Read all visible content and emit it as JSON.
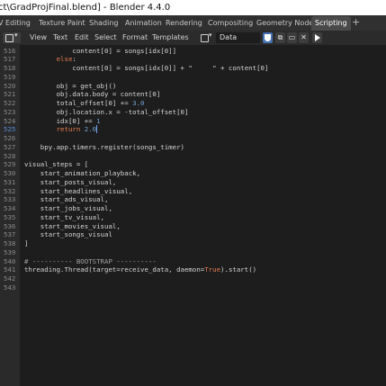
{
  "window": {
    "title": "ct\\GradProjFinal.blend] - Blender 4.4.0"
  },
  "workspace_tabs": [
    {
      "label": "V Editing"
    },
    {
      "label": "Texture Paint"
    },
    {
      "label": "Shading"
    },
    {
      "label": "Animation"
    },
    {
      "label": "Rendering"
    },
    {
      "label": "Compositing"
    },
    {
      "label": "Geometry Nodes"
    },
    {
      "label": "Scripting",
      "active": true
    }
  ],
  "header": {
    "menus": [
      "View",
      "Text",
      "Edit",
      "Select",
      "Format",
      "Templates"
    ],
    "datablock_name": "Data"
  },
  "icons": {
    "editor_type": "text-editor-icon",
    "textblock": "textblock-icon",
    "shield": "shield-icon",
    "copy": "copy-icon",
    "new": "new-file-icon",
    "close": "close-icon",
    "run": "play-icon"
  },
  "editor": {
    "current_line": "525",
    "lines": [
      {
        "num": "516",
        "parts": [
          [
            "t",
            "            content[0] = songs[idx[0]]"
          ]
        ]
      },
      {
        "num": "517",
        "parts": [
          [
            "t",
            "        "
          ],
          [
            "k",
            "else"
          ],
          [
            "t",
            ":"
          ]
        ]
      },
      {
        "num": "518",
        "parts": [
          [
            "t",
            "            content[0] = songs[idx[0]] + \"     \" + content[0]"
          ]
        ]
      },
      {
        "num": "519",
        "parts": [
          [
            "t",
            ""
          ]
        ]
      },
      {
        "num": "520",
        "parts": [
          [
            "t",
            "        obj = get_obj()"
          ]
        ]
      },
      {
        "num": "521",
        "parts": [
          [
            "t",
            "        obj.data.body = content[0]"
          ]
        ]
      },
      {
        "num": "522",
        "parts": [
          [
            "t",
            "        total_offset[0] += "
          ],
          [
            "n",
            "3.0"
          ]
        ]
      },
      {
        "num": "523",
        "parts": [
          [
            "t",
            "        obj.location.x = -total_offset[0]"
          ]
        ]
      },
      {
        "num": "524",
        "parts": [
          [
            "t",
            "        idx[0] += "
          ],
          [
            "n",
            "1"
          ]
        ]
      },
      {
        "num": "525",
        "parts": [
          [
            "t",
            "        "
          ],
          [
            "k",
            "return"
          ],
          [
            "t",
            " "
          ],
          [
            "n",
            "2.0"
          ]
        ]
      },
      {
        "num": "526",
        "parts": [
          [
            "t",
            ""
          ]
        ]
      },
      {
        "num": "527",
        "parts": [
          [
            "t",
            "    bpy.app.timers.register(songs_timer)"
          ]
        ]
      },
      {
        "num": "528",
        "parts": [
          [
            "t",
            ""
          ]
        ]
      },
      {
        "num": "529",
        "parts": [
          [
            "t",
            "visual_steps = ["
          ]
        ]
      },
      {
        "num": "530",
        "parts": [
          [
            "t",
            "    start_animation_playback,"
          ]
        ]
      },
      {
        "num": "531",
        "parts": [
          [
            "t",
            "    start_posts_visual,"
          ]
        ]
      },
      {
        "num": "532",
        "parts": [
          [
            "t",
            "    start_headlines_visual,"
          ]
        ]
      },
      {
        "num": "533",
        "parts": [
          [
            "t",
            "    start_ads_visual,"
          ]
        ]
      },
      {
        "num": "534",
        "parts": [
          [
            "t",
            "    start_jobs_visual,"
          ]
        ]
      },
      {
        "num": "535",
        "parts": [
          [
            "t",
            "    start_tv_visual,"
          ]
        ]
      },
      {
        "num": "536",
        "parts": [
          [
            "t",
            "    start_movies_visual,"
          ]
        ]
      },
      {
        "num": "537",
        "parts": [
          [
            "t",
            "    start_songs_visual"
          ]
        ]
      },
      {
        "num": "538",
        "parts": [
          [
            "t",
            "]"
          ]
        ]
      },
      {
        "num": "539",
        "parts": [
          [
            "t",
            ""
          ]
        ]
      },
      {
        "num": "540",
        "parts": [
          [
            "c",
            "# ---------- BOOTSTRAP ----------"
          ]
        ]
      },
      {
        "num": "541",
        "parts": [
          [
            "t",
            "threading.Thread(target=receive_data, daemon="
          ],
          [
            "k",
            "True"
          ],
          [
            "t",
            ").start()"
          ]
        ]
      },
      {
        "num": "542",
        "parts": [
          [
            "t",
            ""
          ]
        ]
      },
      {
        "num": "543",
        "parts": [
          [
            "t",
            ""
          ]
        ]
      }
    ]
  }
}
